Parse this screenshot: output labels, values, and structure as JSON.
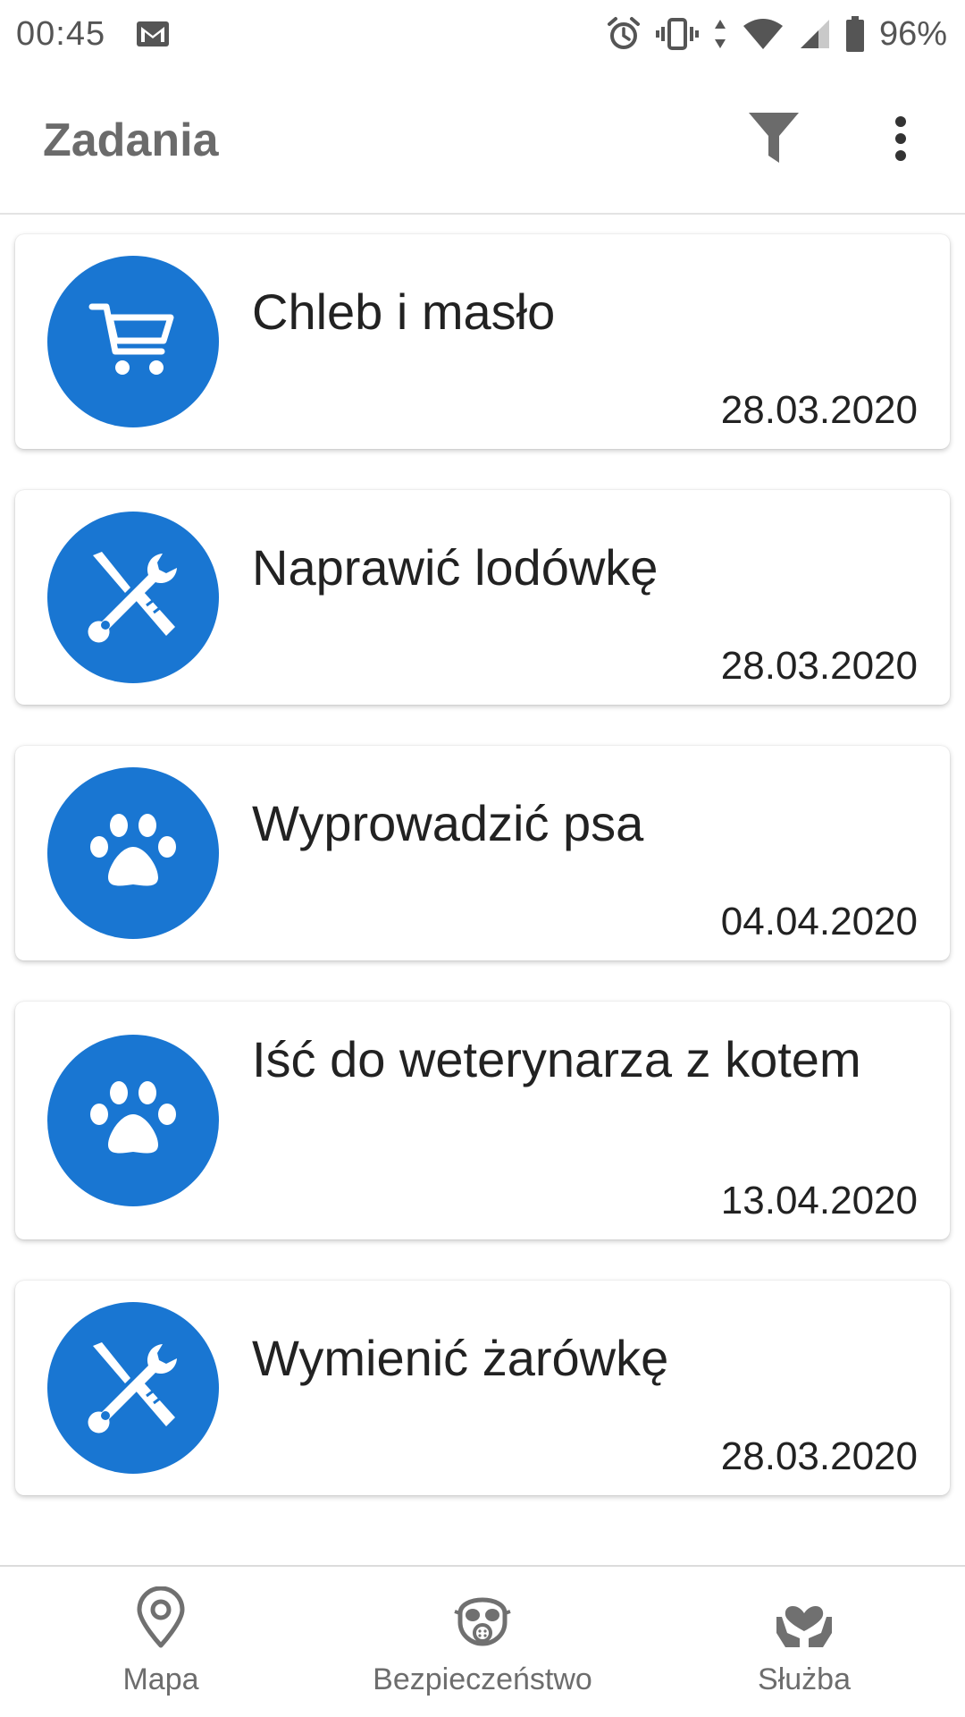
{
  "status_bar": {
    "time": "00:45",
    "battery_percent": "96%"
  },
  "app_bar": {
    "title": "Zadania"
  },
  "tasks": [
    {
      "title": "Chleb i masło",
      "date": "28.03.2020",
      "icon": "shopping-cart-icon"
    },
    {
      "title": "Naprawić lodówkę",
      "date": "28.03.2020",
      "icon": "tools-icon"
    },
    {
      "title": "Wyprowadzić psa",
      "date": "04.04.2020",
      "icon": "paw-icon"
    },
    {
      "title": "Iść do weterynarza z kotem",
      "date": "13.04.2020",
      "icon": "paw-icon"
    },
    {
      "title": "Wymienić żarówkę",
      "date": "28.03.2020",
      "icon": "tools-icon"
    }
  ],
  "bottom_nav": {
    "items": [
      {
        "label": "Mapa",
        "icon": "map-pin-icon"
      },
      {
        "label": "Bezpieczeństwo",
        "icon": "gas-mask-icon"
      },
      {
        "label": "Służba",
        "icon": "heart-hands-icon"
      }
    ]
  },
  "colors": {
    "accent": "#1976d2",
    "title_gray": "#6b6b6b",
    "icon_gray": "#555555"
  }
}
